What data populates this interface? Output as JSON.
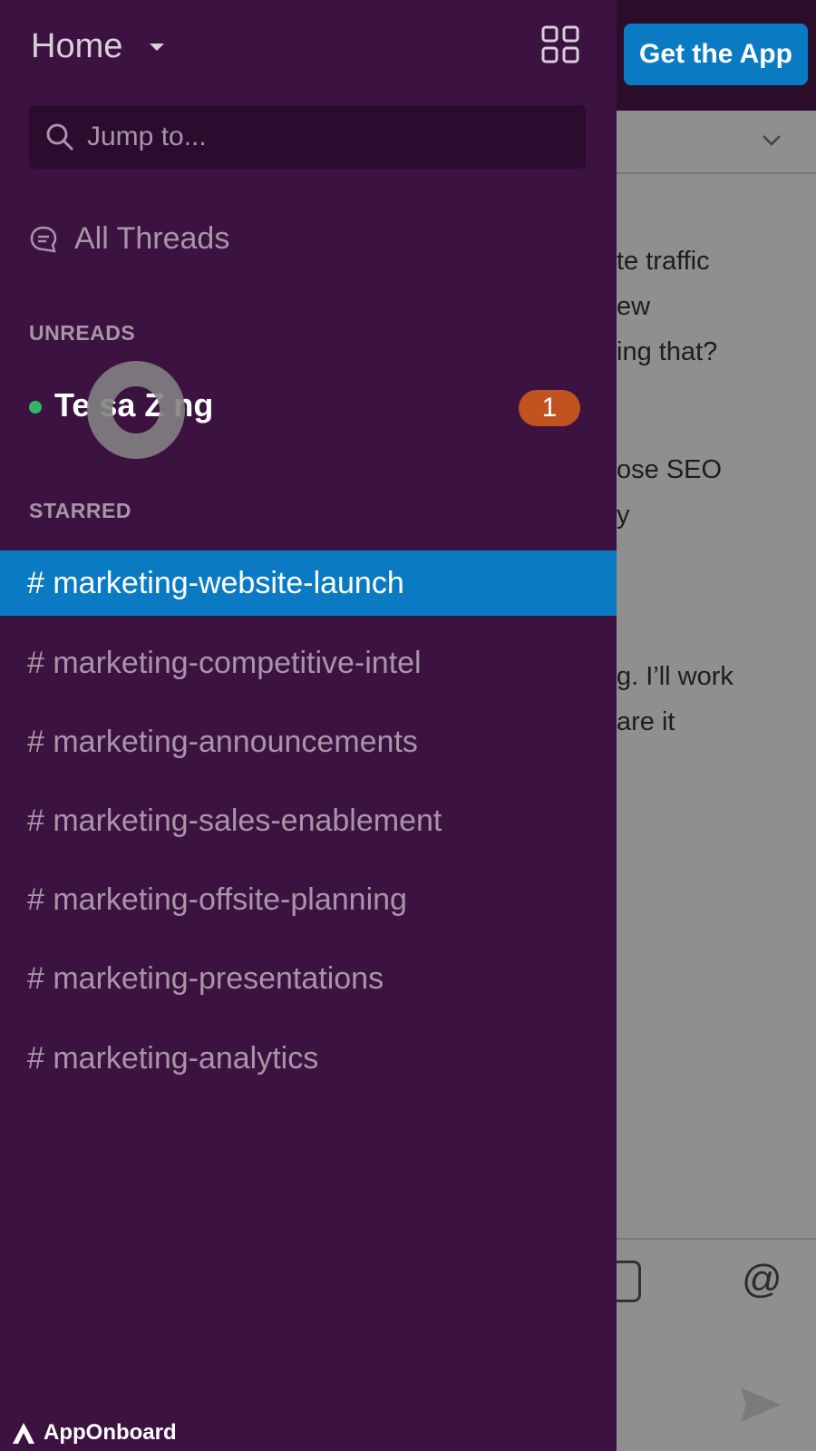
{
  "background": {
    "get_app_label": "Get the App",
    "message_fragments": [
      "te traffic",
      "ew",
      "ing that?",
      "ose SEO",
      "y",
      "g. I’ll work",
      "are it"
    ]
  },
  "drawer": {
    "workspace_title": "Home",
    "search_placeholder": "Jump to...",
    "all_threads_label": "All Threads",
    "unreads_label": "UNREADS",
    "unread_dm": {
      "name": "Te sa Z ng",
      "badge": "1",
      "status_color": "#33b46a"
    },
    "starred_label": "STARRED",
    "channels": [
      {
        "label": "# marketing-website-launch",
        "active": true
      },
      {
        "label": "# marketing-competitive-intel",
        "active": false
      },
      {
        "label": "# marketing-announcements",
        "active": false
      },
      {
        "label": "# marketing-sales-enablement",
        "active": false
      },
      {
        "label": "# marketing-offsite-planning",
        "active": false
      },
      {
        "label": "# marketing-presentations",
        "active": false
      },
      {
        "label": "# marketing-analytics",
        "active": false
      }
    ]
  },
  "watermark": {
    "brand": "AppOnboard"
  },
  "colors": {
    "drawer_bg": "#3c1340",
    "active_blue": "#0a7bc2",
    "badge": "#c0531f",
    "muted_text": "#a895a8"
  }
}
